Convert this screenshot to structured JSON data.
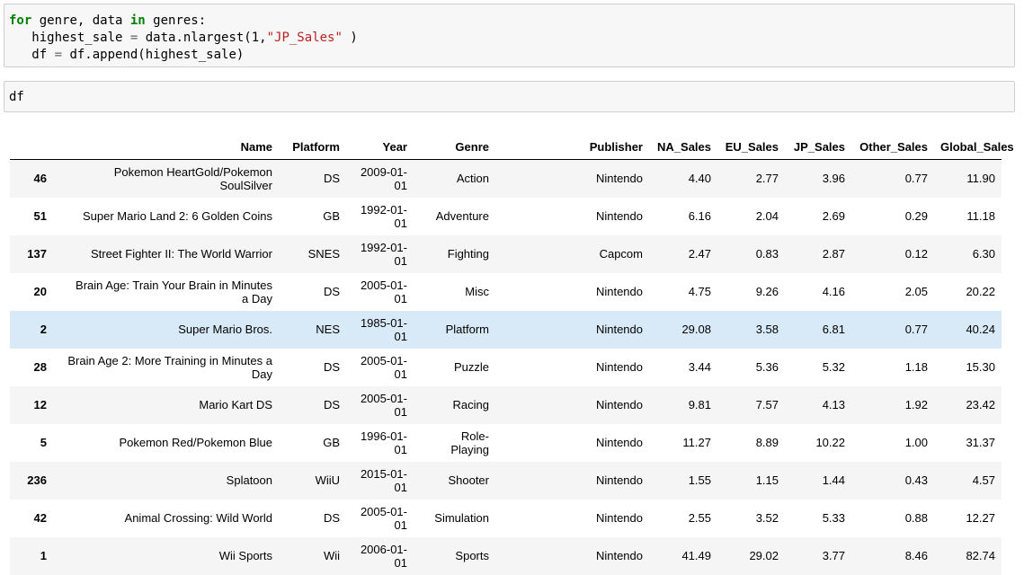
{
  "code_cell": {
    "lines": [
      {
        "kw1": "for",
        "t1": " genre, data ",
        "kw2": "in",
        "t2": " genres:"
      },
      {
        "t1": "   highest_sale ",
        "op": "=",
        "t2": " data.nlargest(1,",
        "str": "\"JP_Sales\"",
        "t3": " )"
      },
      {
        "t1": "   df ",
        "op": "=",
        "t2": " df.append(highest_sale)"
      }
    ]
  },
  "df_cell": {
    "code": "df"
  },
  "table": {
    "columns": [
      "",
      "Name",
      "Platform",
      "Year",
      "Genre",
      "Publisher",
      "NA_Sales",
      "EU_Sales",
      "JP_Sales",
      "Other_Sales",
      "Global_Sales"
    ],
    "rows": [
      {
        "index": "46",
        "name_1": "Pokemon HeartGold/Pokemon",
        "name_2": "SoulSilver",
        "platform": "DS",
        "year_1": "2009-01-",
        "year_2": "01",
        "genre_1": "Action",
        "genre_2": "",
        "publisher": "Nintendo",
        "na": "4.40",
        "eu": "2.77",
        "jp": "3.96",
        "other": "0.77",
        "global": "11.90"
      },
      {
        "index": "51",
        "name_1": "Super Mario Land 2: 6 Golden Coins",
        "name_2": "",
        "platform": "GB",
        "year_1": "1992-01-",
        "year_2": "01",
        "genre_1": "Adventure",
        "genre_2": "",
        "publisher": "Nintendo",
        "na": "6.16",
        "eu": "2.04",
        "jp": "2.69",
        "other": "0.29",
        "global": "11.18"
      },
      {
        "index": "137",
        "name_1": "Street Fighter II: The World Warrior",
        "name_2": "",
        "platform": "SNES",
        "year_1": "1992-01-",
        "year_2": "01",
        "genre_1": "Fighting",
        "genre_2": "",
        "publisher": "Capcom",
        "na": "2.47",
        "eu": "0.83",
        "jp": "2.87",
        "other": "0.12",
        "global": "6.30"
      },
      {
        "index": "20",
        "name_1": "Brain Age: Train Your Brain in Minutes",
        "name_2": "a Day",
        "platform": "DS",
        "year_1": "2005-01-",
        "year_2": "01",
        "genre_1": "Misc",
        "genre_2": "",
        "publisher": "Nintendo",
        "na": "4.75",
        "eu": "9.26",
        "jp": "4.16",
        "other": "2.05",
        "global": "20.22"
      },
      {
        "index": "2",
        "name_1": "Super Mario Bros.",
        "name_2": "",
        "platform": "NES",
        "year_1": "1985-01-",
        "year_2": "01",
        "genre_1": "Platform",
        "genre_2": "",
        "publisher": "Nintendo",
        "na": "29.08",
        "eu": "3.58",
        "jp": "6.81",
        "other": "0.77",
        "global": "40.24"
      },
      {
        "index": "28",
        "name_1": "Brain Age 2: More Training in Minutes a",
        "name_2": "Day",
        "platform": "DS",
        "year_1": "2005-01-",
        "year_2": "01",
        "genre_1": "Puzzle",
        "genre_2": "",
        "publisher": "Nintendo",
        "na": "3.44",
        "eu": "5.36",
        "jp": "5.32",
        "other": "1.18",
        "global": "15.30"
      },
      {
        "index": "12",
        "name_1": "Mario Kart DS",
        "name_2": "",
        "platform": "DS",
        "year_1": "2005-01-",
        "year_2": "01",
        "genre_1": "Racing",
        "genre_2": "",
        "publisher": "Nintendo",
        "na": "9.81",
        "eu": "7.57",
        "jp": "4.13",
        "other": "1.92",
        "global": "23.42"
      },
      {
        "index": "5",
        "name_1": "Pokemon Red/Pokemon Blue",
        "name_2": "",
        "platform": "GB",
        "year_1": "1996-01-",
        "year_2": "01",
        "genre_1": "Role-",
        "genre_2": "Playing",
        "publisher": "Nintendo",
        "na": "11.27",
        "eu": "8.89",
        "jp": "10.22",
        "other": "1.00",
        "global": "31.37"
      },
      {
        "index": "236",
        "name_1": "Splatoon",
        "name_2": "",
        "platform": "WiiU",
        "year_1": "2015-01-",
        "year_2": "01",
        "genre_1": "Shooter",
        "genre_2": "",
        "publisher": "Nintendo",
        "na": "1.55",
        "eu": "1.15",
        "jp": "1.44",
        "other": "0.43",
        "global": "4.57"
      },
      {
        "index": "42",
        "name_1": "Animal Crossing: Wild World",
        "name_2": "",
        "platform": "DS",
        "year_1": "2005-01-",
        "year_2": "01",
        "genre_1": "Simulation",
        "genre_2": "",
        "publisher": "Nintendo",
        "na": "2.55",
        "eu": "3.52",
        "jp": "5.33",
        "other": "0.88",
        "global": "12.27"
      },
      {
        "index": "1",
        "name_1": "Wii Sports",
        "name_2": "",
        "platform": "Wii",
        "year_1": "2006-01-",
        "year_2": "01",
        "genre_1": "Sports",
        "genre_2": "",
        "publisher": "Nintendo",
        "na": "41.49",
        "eu": "29.02",
        "jp": "3.77",
        "other": "8.46",
        "global": "82.74"
      }
    ],
    "highlighted_row_index": 4
  },
  "colors": {
    "keyword": "#008000",
    "string": "#ba2121",
    "cell_bg": "#f7f7f7",
    "row_stripe": "#f5f5f5",
    "row_hover": "#d8eaf8"
  }
}
